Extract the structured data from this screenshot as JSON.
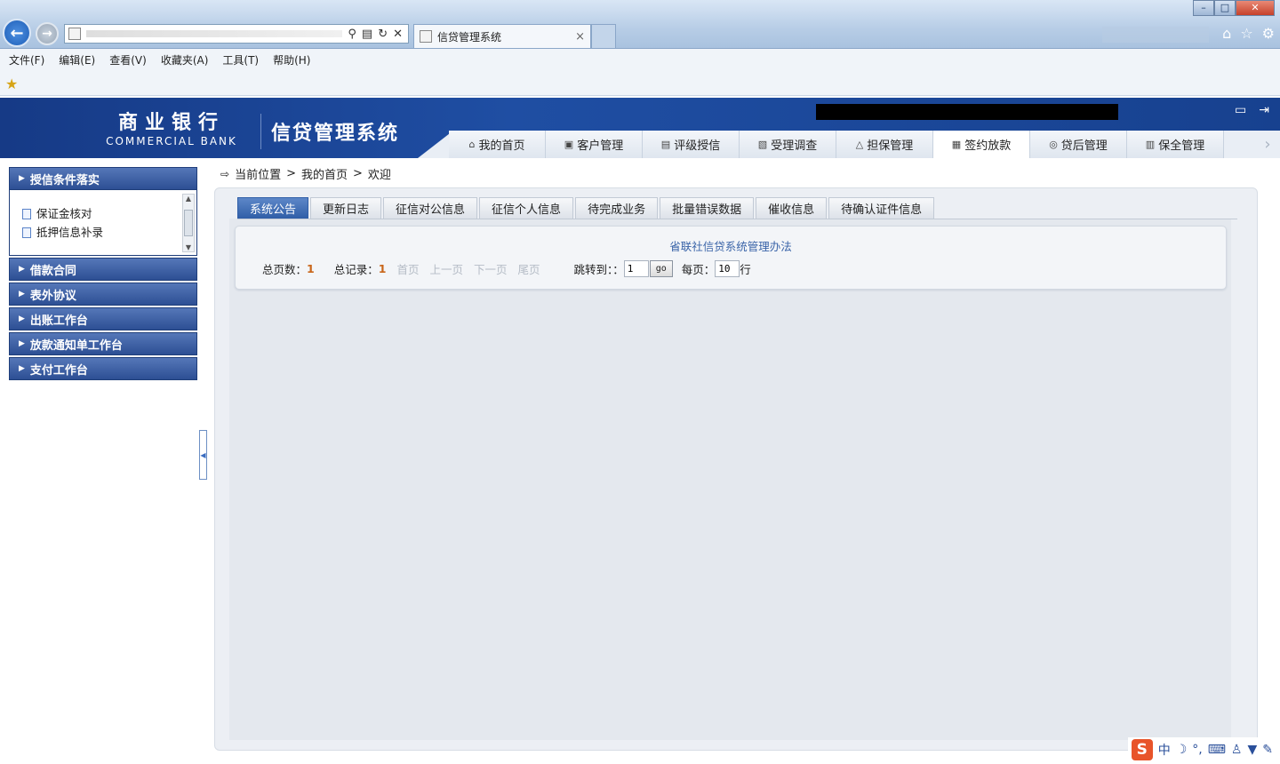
{
  "browser": {
    "tab_title": "信贷管理系统",
    "tab_close": "×",
    "menu": [
      "文件(F)",
      "编辑(E)",
      "查看(V)",
      "收藏夹(A)",
      "工具(T)",
      "帮助(H)"
    ],
    "win_min": "–",
    "win_max": "□",
    "win_close": "✕"
  },
  "app": {
    "brand_cn": "商业银行",
    "brand_en": "COMMERCIAL BANK",
    "system_name": "信贷管理系统",
    "nav": [
      {
        "label": "我的首页",
        "icon": "home-icon",
        "glyph": "⌂"
      },
      {
        "label": "客户管理",
        "icon": "customer-icon",
        "glyph": "▣"
      },
      {
        "label": "评级授信",
        "icon": "rating-icon",
        "glyph": "▤"
      },
      {
        "label": "受理调查",
        "icon": "survey-icon",
        "glyph": "▧"
      },
      {
        "label": "担保管理",
        "icon": "guarantee-icon",
        "glyph": "△"
      },
      {
        "label": "签约放款",
        "icon": "contract-icon",
        "glyph": "▦",
        "active": true
      },
      {
        "label": "贷后管理",
        "icon": "postloan-icon",
        "glyph": "◎"
      },
      {
        "label": "保全管理",
        "icon": "preserve-icon",
        "glyph": "▥"
      }
    ]
  },
  "sidebar": {
    "groups": [
      {
        "label": "授信条件落实",
        "items": [
          "保证金核对",
          "抵押信息补录"
        ]
      },
      {
        "label": "借款合同"
      },
      {
        "label": "表外协议"
      },
      {
        "label": "出账工作台"
      },
      {
        "label": "放款通知单工作台"
      },
      {
        "label": "支付工作台"
      }
    ]
  },
  "breadcrumb": {
    "label": "当前位置",
    "sep": ">",
    "path": [
      "我的首页",
      "欢迎"
    ]
  },
  "subtabs": [
    "系统公告",
    "更新日志",
    "征信对公信息",
    "征信个人信息",
    "待完成业务",
    "批量错误数据",
    "催收信息",
    "待确认证件信息"
  ],
  "notice": {
    "title": "省联社信贷系统管理办法"
  },
  "pager": {
    "total_pages_label": "总页数：",
    "total_pages": "1",
    "total_records_label": "总记录：",
    "total_records": "1",
    "first": "首页",
    "prev": "上一页",
    "next": "下一页",
    "last": "尾页",
    "jump_label": "跳转到：：",
    "jump_value": "1",
    "go": "go",
    "per_page_label": "每页：",
    "per_page_value": "10",
    "per_page_unit": "行"
  },
  "tray": {
    "ime": "中"
  },
  "colors": {
    "header_blue": "#1f4ea3",
    "active_subtab": "#2f5ea7",
    "count_orange": "#c9661a"
  }
}
